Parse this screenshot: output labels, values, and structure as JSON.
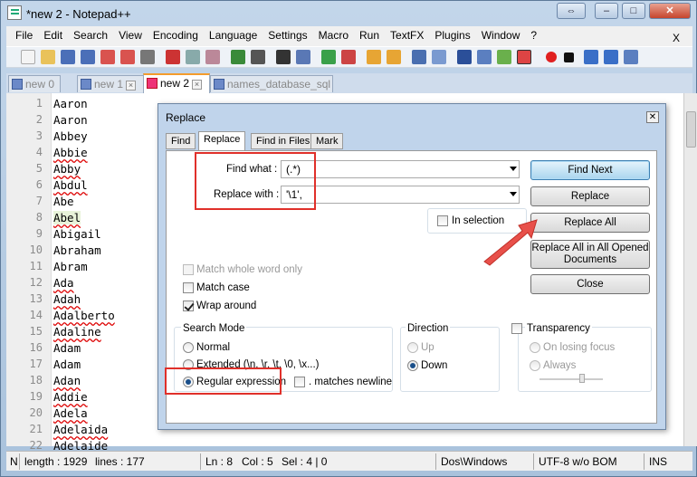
{
  "window": {
    "title": "*new  2 - Notepad++"
  },
  "menu": [
    "File",
    "Edit",
    "Search",
    "View",
    "Encoding",
    "Language",
    "Settings",
    "Macro",
    "Run",
    "TextFX",
    "Plugins",
    "Window",
    "?"
  ],
  "menu_close": "X",
  "tabs": [
    {
      "label": "new  0",
      "active": false
    },
    {
      "label": "new  1",
      "active": false
    },
    {
      "label": "new  2",
      "active": true
    },
    {
      "label": "names_database_sql",
      "active": false
    }
  ],
  "editor": {
    "lines": [
      {
        "n": "1",
        "text": "Aaron"
      },
      {
        "n": "2",
        "text": "Aaron"
      },
      {
        "n": "3",
        "text": "Abbey"
      },
      {
        "n": "4",
        "text": "Abbie"
      },
      {
        "n": "5",
        "text": "Abby"
      },
      {
        "n": "6",
        "text": "Abdul"
      },
      {
        "n": "7",
        "text": "Abe"
      },
      {
        "n": "8",
        "text": "Abel"
      },
      {
        "n": "9",
        "text": "Abigail"
      },
      {
        "n": "10",
        "text": "Abraham"
      },
      {
        "n": "11",
        "text": "Abram"
      },
      {
        "n": "12",
        "text": "Ada"
      },
      {
        "n": "13",
        "text": "Adah"
      },
      {
        "n": "14",
        "text": "Adalberto"
      },
      {
        "n": "15",
        "text": "Adaline"
      },
      {
        "n": "16",
        "text": "Adam"
      },
      {
        "n": "17",
        "text": "Adam"
      },
      {
        "n": "18",
        "text": "Adan"
      },
      {
        "n": "19",
        "text": "Addie"
      },
      {
        "n": "20",
        "text": "Adela"
      },
      {
        "n": "21",
        "text": "Adelaida"
      },
      {
        "n": "22",
        "text": "Adelaide"
      }
    ]
  },
  "status": {
    "length": "length : 1929",
    "lines": "lines : 177",
    "ln": "Ln : 8",
    "col": "Col : 5",
    "sel": "Sel : 4 | 0",
    "eol": "Dos\\Windows",
    "encoding": "UTF-8 w/o BOM",
    "mode": "INS",
    "left_cut": "N"
  },
  "dialog": {
    "title": "Replace",
    "tabs": [
      "Find",
      "Replace",
      "Find in Files",
      "Mark"
    ],
    "find_label": "Find what :",
    "find_value": "(.*)",
    "replace_label": "Replace with :",
    "replace_value": "'\\1',",
    "in_selection": "In selection",
    "buttons": {
      "find_next": "Find Next",
      "replace": "Replace",
      "replace_all": "Replace All",
      "replace_all_opened": "Replace All in All Opened Documents",
      "close": "Close"
    },
    "options": {
      "whole_word": "Match whole word only",
      "match_case": "Match case",
      "wrap_around": "Wrap around"
    },
    "search_mode": {
      "title": "Search Mode",
      "normal": "Normal",
      "extended": "Extended (\\n, \\r, \\t, \\0, \\x...)",
      "regex": "Regular expression",
      "matches_newline": ". matches newline"
    },
    "direction": {
      "title": "Direction",
      "up": "Up",
      "down": "Down"
    },
    "transparency": {
      "title": "Transparency",
      "on_losing_focus": "On losing focus",
      "always": "Always"
    }
  },
  "colors": {
    "annotation": "#e0302a",
    "highlight_line": "#e8f3d9",
    "active_tab_accent": "#f49c2c"
  }
}
